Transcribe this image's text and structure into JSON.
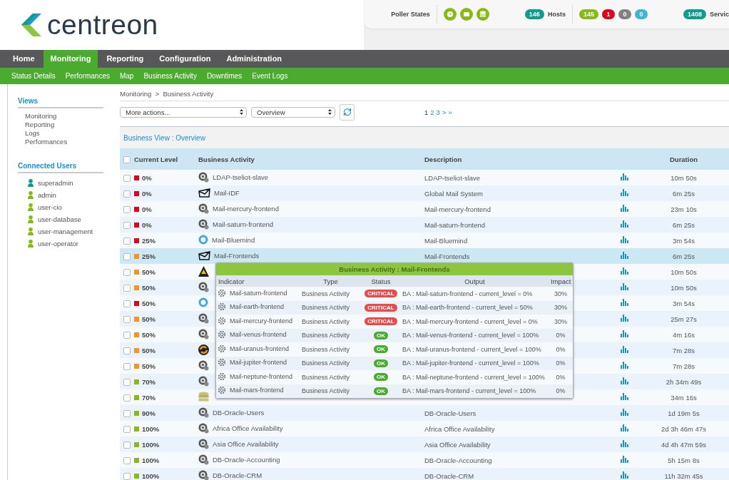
{
  "header": {
    "logo_text": "centreon",
    "poller_states": {
      "label": "Poller States"
    },
    "hosts": {
      "total": "146",
      "label": "Hosts",
      "counts": [
        {
          "value": "145",
          "color": "#88b917"
        },
        {
          "value": "1",
          "color": "#e2001a"
        },
        {
          "value": "0",
          "color": "#818181"
        },
        {
          "value": "0",
          "color": "#3fb6d1"
        }
      ]
    },
    "services": {
      "total": "1408",
      "label": "Servic"
    }
  },
  "menu": [
    {
      "label": "Home",
      "selected": false
    },
    {
      "label": "Monitoring",
      "selected": true
    },
    {
      "label": "Reporting",
      "selected": false
    },
    {
      "label": "Configuration",
      "selected": false
    },
    {
      "label": "Administration",
      "selected": false
    }
  ],
  "submenu": [
    "Status Details",
    "Performances",
    "Map",
    "Business Activity",
    "Downtimes",
    "Event Logs"
  ],
  "sidebar": {
    "views": {
      "title": "Views",
      "items": [
        "Monitoring",
        "Reporting",
        "Logs",
        "Performances"
      ]
    },
    "connected_users": {
      "title": "Connected Users",
      "users": [
        {
          "name": "superadmin",
          "color": "#0e9c8f"
        },
        {
          "name": "admin",
          "color": "#88b917"
        },
        {
          "name": "user-cio",
          "color": "#88b917"
        },
        {
          "name": "user-database",
          "color": "#88b917"
        },
        {
          "name": "user-management",
          "color": "#88b917"
        },
        {
          "name": "user-operator",
          "color": "#88b917"
        }
      ]
    }
  },
  "breadcrumb": "Monitoring  >  Business Activity",
  "toolbar": {
    "actions_select": "More actions...",
    "view_select": "Overview"
  },
  "pagination": [
    {
      "label": "1",
      "selected": true
    },
    {
      "label": "2",
      "selected": false
    },
    {
      "label": "3",
      "selected": false
    },
    {
      "label": ">",
      "selected": false
    },
    {
      "label": "»",
      "selected": false
    }
  ],
  "panel_title": "Business View : Overview",
  "table": {
    "select_all_checked": false,
    "columns": {
      "level": "Current Level",
      "activity": "Business Activity",
      "description": "Description",
      "duration": "Duration"
    },
    "rows": [
      {
        "checked": false,
        "selected": false,
        "current_level": "0%",
        "color": "#e2001a",
        "kind": "gauge",
        "name": "LDAP-tseliot-slave",
        "description": "LDAP-tseliot-slave",
        "duration": "10m 50s"
      },
      {
        "checked": false,
        "selected": false,
        "current_level": "0%",
        "color": "#e2001a",
        "kind": "mail",
        "name": "Mail-IDF",
        "description": "Global Mail System",
        "duration": "6m 25s"
      },
      {
        "checked": false,
        "selected": false,
        "current_level": "0%",
        "color": "#e2001a",
        "kind": "gauge",
        "name": "Mail-mercury-frontend",
        "description": "Mail-mercury-frontend",
        "duration": "23m 10s"
      },
      {
        "checked": false,
        "selected": false,
        "current_level": "0%",
        "color": "#e2001a",
        "kind": "gauge",
        "name": "Mail-saturn-frontend",
        "description": "Mail-saturn-frontend",
        "duration": "6m 25s"
      },
      {
        "checked": false,
        "selected": false,
        "current_level": "25%",
        "color": "#e2001a",
        "kind": "ring",
        "name": "Mail-Bluemind",
        "description": "Mail-Bluemind",
        "duration": "3m 54s"
      },
      {
        "checked": false,
        "selected": true,
        "current_level": "25%",
        "color": "#f7931e",
        "kind": "mail",
        "name": "Mail-Frontends",
        "description": "Mail-Frontends",
        "duration": "6m 25s"
      },
      {
        "checked": false,
        "selected": false,
        "current_level": "50%",
        "color": "#f7931e",
        "kind": "pyramid",
        "duration": "10m 50s"
      },
      {
        "checked": false,
        "selected": false,
        "current_level": "50%",
        "color": "#f7931e",
        "kind": "gauge",
        "duration": "10m 50s"
      },
      {
        "checked": false,
        "selected": false,
        "current_level": "50%",
        "color": "#e2001a",
        "kind": "ring",
        "duration": "3m 54s"
      },
      {
        "checked": false,
        "selected": false,
        "current_level": "50%",
        "color": "#f7931e",
        "kind": "gauge",
        "duration": "25m 27s"
      },
      {
        "checked": false,
        "selected": false,
        "current_level": "50%",
        "color": "#f7931e",
        "kind": "gauge",
        "duration": "4m 16s"
      },
      {
        "checked": false,
        "selected": false,
        "current_level": "50%",
        "color": "#f7931e",
        "kind": "sync",
        "duration": "7m 28s"
      },
      {
        "checked": false,
        "selected": false,
        "current_level": "50%",
        "color": "#f7931e",
        "kind": "gauge",
        "duration": "7m 28s"
      },
      {
        "checked": false,
        "selected": false,
        "current_level": "70%",
        "color": "#88b917",
        "kind": "gauge",
        "duration": "2h 34m 49s"
      },
      {
        "checked": false,
        "selected": false,
        "current_level": "70%",
        "color": "#88b917",
        "kind": "database",
        "duration": "34m 16s"
      },
      {
        "checked": false,
        "selected": false,
        "current_level": "90%",
        "color": "#88b917",
        "kind": "gauge",
        "name": "DB-Oracle-Users",
        "description": "DB-Oracle-Users",
        "duration": "1d 19m 5s"
      },
      {
        "checked": false,
        "selected": false,
        "current_level": "100%",
        "color": "#88b917",
        "kind": "gauge",
        "name": "Africa Office Availability",
        "description": "Africa Office Availability",
        "duration": "2d 3h 46m 47s"
      },
      {
        "checked": false,
        "selected": false,
        "current_level": "100%",
        "color": "#88b917",
        "kind": "gauge",
        "name": "Asia Office Availability",
        "description": "Asia Office Availability",
        "duration": "4d 4h 47m 59s"
      },
      {
        "checked": false,
        "selected": false,
        "current_level": "100%",
        "color": "#88b917",
        "kind": "gauge",
        "name": "DB-Oracle-Accounting",
        "description": "DB-Oracle-Accounting",
        "duration": "5h 15m 8s"
      },
      {
        "checked": false,
        "selected": false,
        "current_level": "100%",
        "color": "#88b917",
        "kind": "gauge",
        "name": "DB-Oracle-CRM",
        "description": "DB-Oracle-CRM",
        "duration": "11h 32m 45s"
      }
    ]
  },
  "popup": {
    "title": "Business Activity : Mail-Frontends",
    "columns": {
      "indicator": "Indicator",
      "type": "Type",
      "status": "Status",
      "output": "Output",
      "impact": "Impact"
    },
    "rows": [
      {
        "indicator": "Mail-saturn-frontend",
        "type": "Business Activity",
        "status": "CRITICAL",
        "kind": "critical",
        "output": "BA : Mail-saturn-frontend - current_level = 0%",
        "impact": "30%"
      },
      {
        "indicator": "Mail-earth-frontend",
        "type": "Business Activity",
        "status": "CRITICAL",
        "kind": "critical",
        "output": "BA : Mail-earth-frontend - current_level = 50%",
        "impact": "30%"
      },
      {
        "indicator": "Mail-mercury-frontend",
        "type": "Business Activity",
        "status": "CRITICAL",
        "kind": "critical",
        "output": "BA : Mail-mercury-frontend - current_level = 0%",
        "impact": "30%"
      },
      {
        "indicator": "Mail-venus-frontend",
        "type": "Business Activity",
        "status": "OK",
        "kind": "ok",
        "output": "BA : Mail-venus-frontend - current_level = 100%",
        "impact": "0%"
      },
      {
        "indicator": "Mail-uranus-frontend",
        "type": "Business Activity",
        "status": "OK",
        "kind": "ok",
        "output": "BA : Mail-uranus-frontend - current_level = 100%",
        "impact": "0%"
      },
      {
        "indicator": "Mail-jupiter-frontend",
        "type": "Business Activity",
        "status": "OK",
        "kind": "ok",
        "output": "BA : Mail-jupiter-frontend - current_level = 100%",
        "impact": "0%"
      },
      {
        "indicator": "Mail-neptune-frontend",
        "type": "Business Activity",
        "status": "OK",
        "kind": "ok",
        "output": "BA : Mail-neptune-frontend - current_level = 100%",
        "impact": "0%"
      },
      {
        "indicator": "Mail-mars-frontend",
        "type": "Business Activity",
        "status": "OK",
        "kind": "ok",
        "output": "BA : Mail-mars-frontend - current_level = 100%",
        "impact": "0%"
      }
    ]
  }
}
